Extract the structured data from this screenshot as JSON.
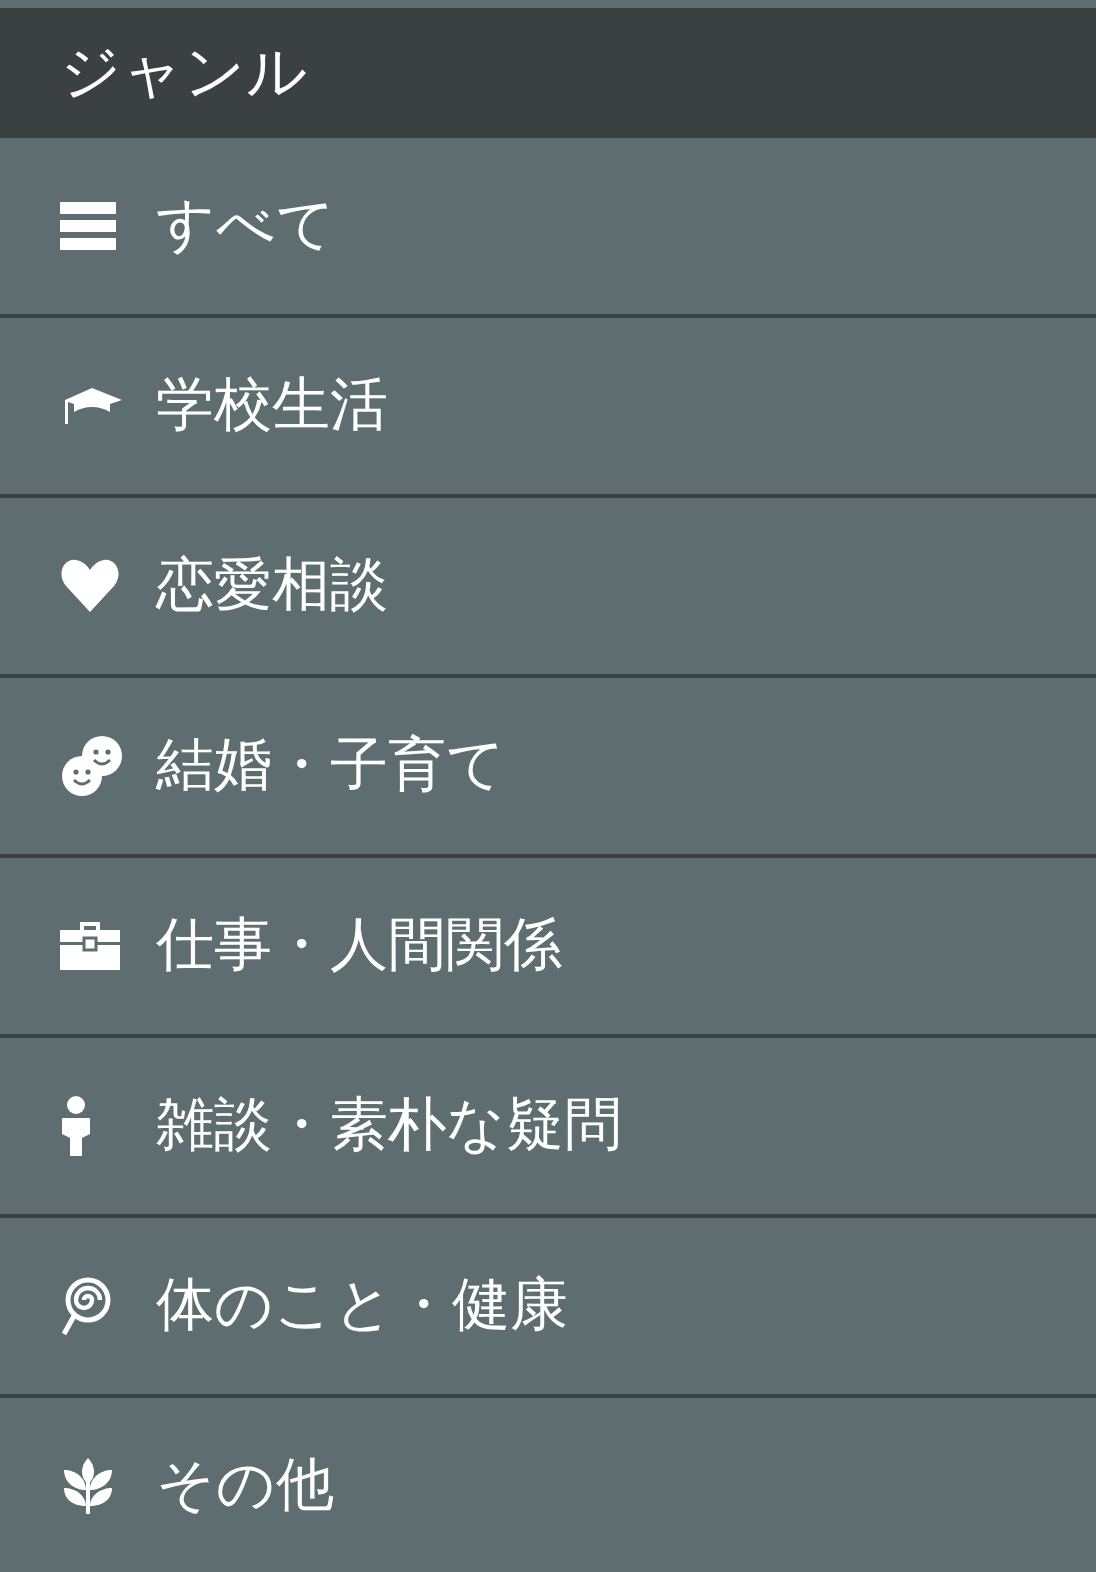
{
  "header": {
    "title": "ジャンル"
  },
  "items": [
    {
      "label": "すべて",
      "kind": "list"
    },
    {
      "label": "学校生活",
      "kind": "cap"
    },
    {
      "label": "恋愛相談",
      "kind": "heart"
    },
    {
      "label": "結婚・子育て",
      "kind": "faces"
    },
    {
      "label": "仕事・人間関係",
      "kind": "briefcase"
    },
    {
      "label": "雑談・素朴な疑問",
      "kind": "person"
    },
    {
      "label": "体のこと・健康",
      "kind": "lollipop"
    },
    {
      "label": "その他",
      "kind": "sprout"
    }
  ]
}
